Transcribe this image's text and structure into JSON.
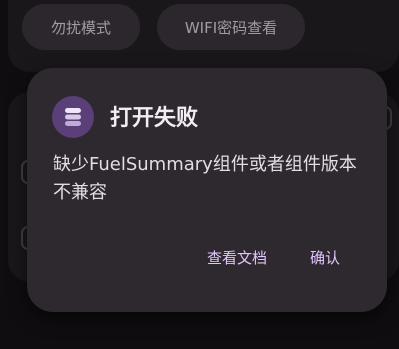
{
  "background": {
    "chips": [
      {
        "label": "勿扰模式"
      },
      {
        "label": "WIFI密码查看"
      }
    ]
  },
  "dialog": {
    "app_icon": "stack-layers-icon",
    "title": "打开失败",
    "message": "缺少FuelSummary组件或者组件版本不兼容",
    "actions": {
      "view_docs": "查看文档",
      "confirm": "确认"
    }
  },
  "colors": {
    "dialog_bg": "#2e282f",
    "accent": "#e1c5ff",
    "icon_bg": "#5a3f78"
  }
}
